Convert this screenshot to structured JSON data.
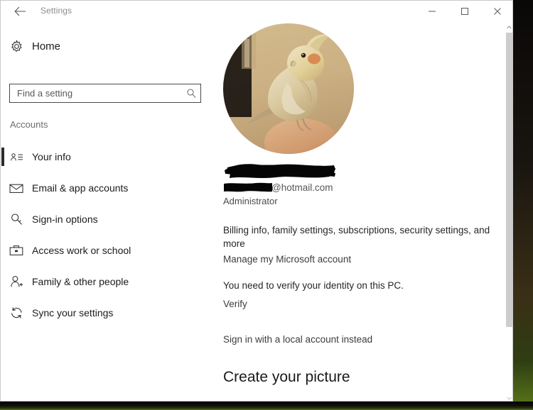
{
  "window": {
    "title": "Settings",
    "back_icon": "back-arrow-icon",
    "controls": {
      "minimize": "minimize-icon",
      "maximize": "maximize-icon",
      "close": "close-icon"
    }
  },
  "sidebar": {
    "home": {
      "label": "Home",
      "icon": "gear-icon"
    },
    "search": {
      "placeholder": "Find a setting",
      "value": "",
      "icon": "search-icon"
    },
    "group_title": "Accounts",
    "items": [
      {
        "label": "Your info",
        "icon": "contact-card-icon",
        "selected": true
      },
      {
        "label": "Email & app accounts",
        "icon": "envelope-icon",
        "selected": false
      },
      {
        "label": "Sign-in options",
        "icon": "key-icon",
        "selected": false
      },
      {
        "label": "Access work or school",
        "icon": "briefcase-icon",
        "selected": false
      },
      {
        "label": "Family & other people",
        "icon": "add-person-icon",
        "selected": false
      },
      {
        "label": "Sync your settings",
        "icon": "sync-icon",
        "selected": false
      }
    ]
  },
  "content": {
    "avatar": {
      "icon": "user-avatar-photo",
      "description": "cockatiel bird perched on a shoulder"
    },
    "account": {
      "display_name": "",
      "display_name_redacted": true,
      "email_local_redacted": true,
      "email_domain": "@hotmail.com",
      "role": "Administrator"
    },
    "description": "Billing info, family settings, subscriptions, security settings, and more",
    "manage_link": "Manage my Microsoft account",
    "verify_message": "You need to verify your identity on this PC.",
    "verify_link": "Verify",
    "local_account_link": "Sign in with a local account instead",
    "section_heading": "Create your picture"
  },
  "scrollbar": {
    "up_icon": "chevron-up-icon",
    "down_icon": "chevron-down-icon"
  },
  "colors": {
    "accent": "#2b2b2b",
    "window_bg": "#ffffff",
    "text": "#1b1b1b",
    "muted": "#6e6e6e",
    "redaction": "#000000"
  }
}
